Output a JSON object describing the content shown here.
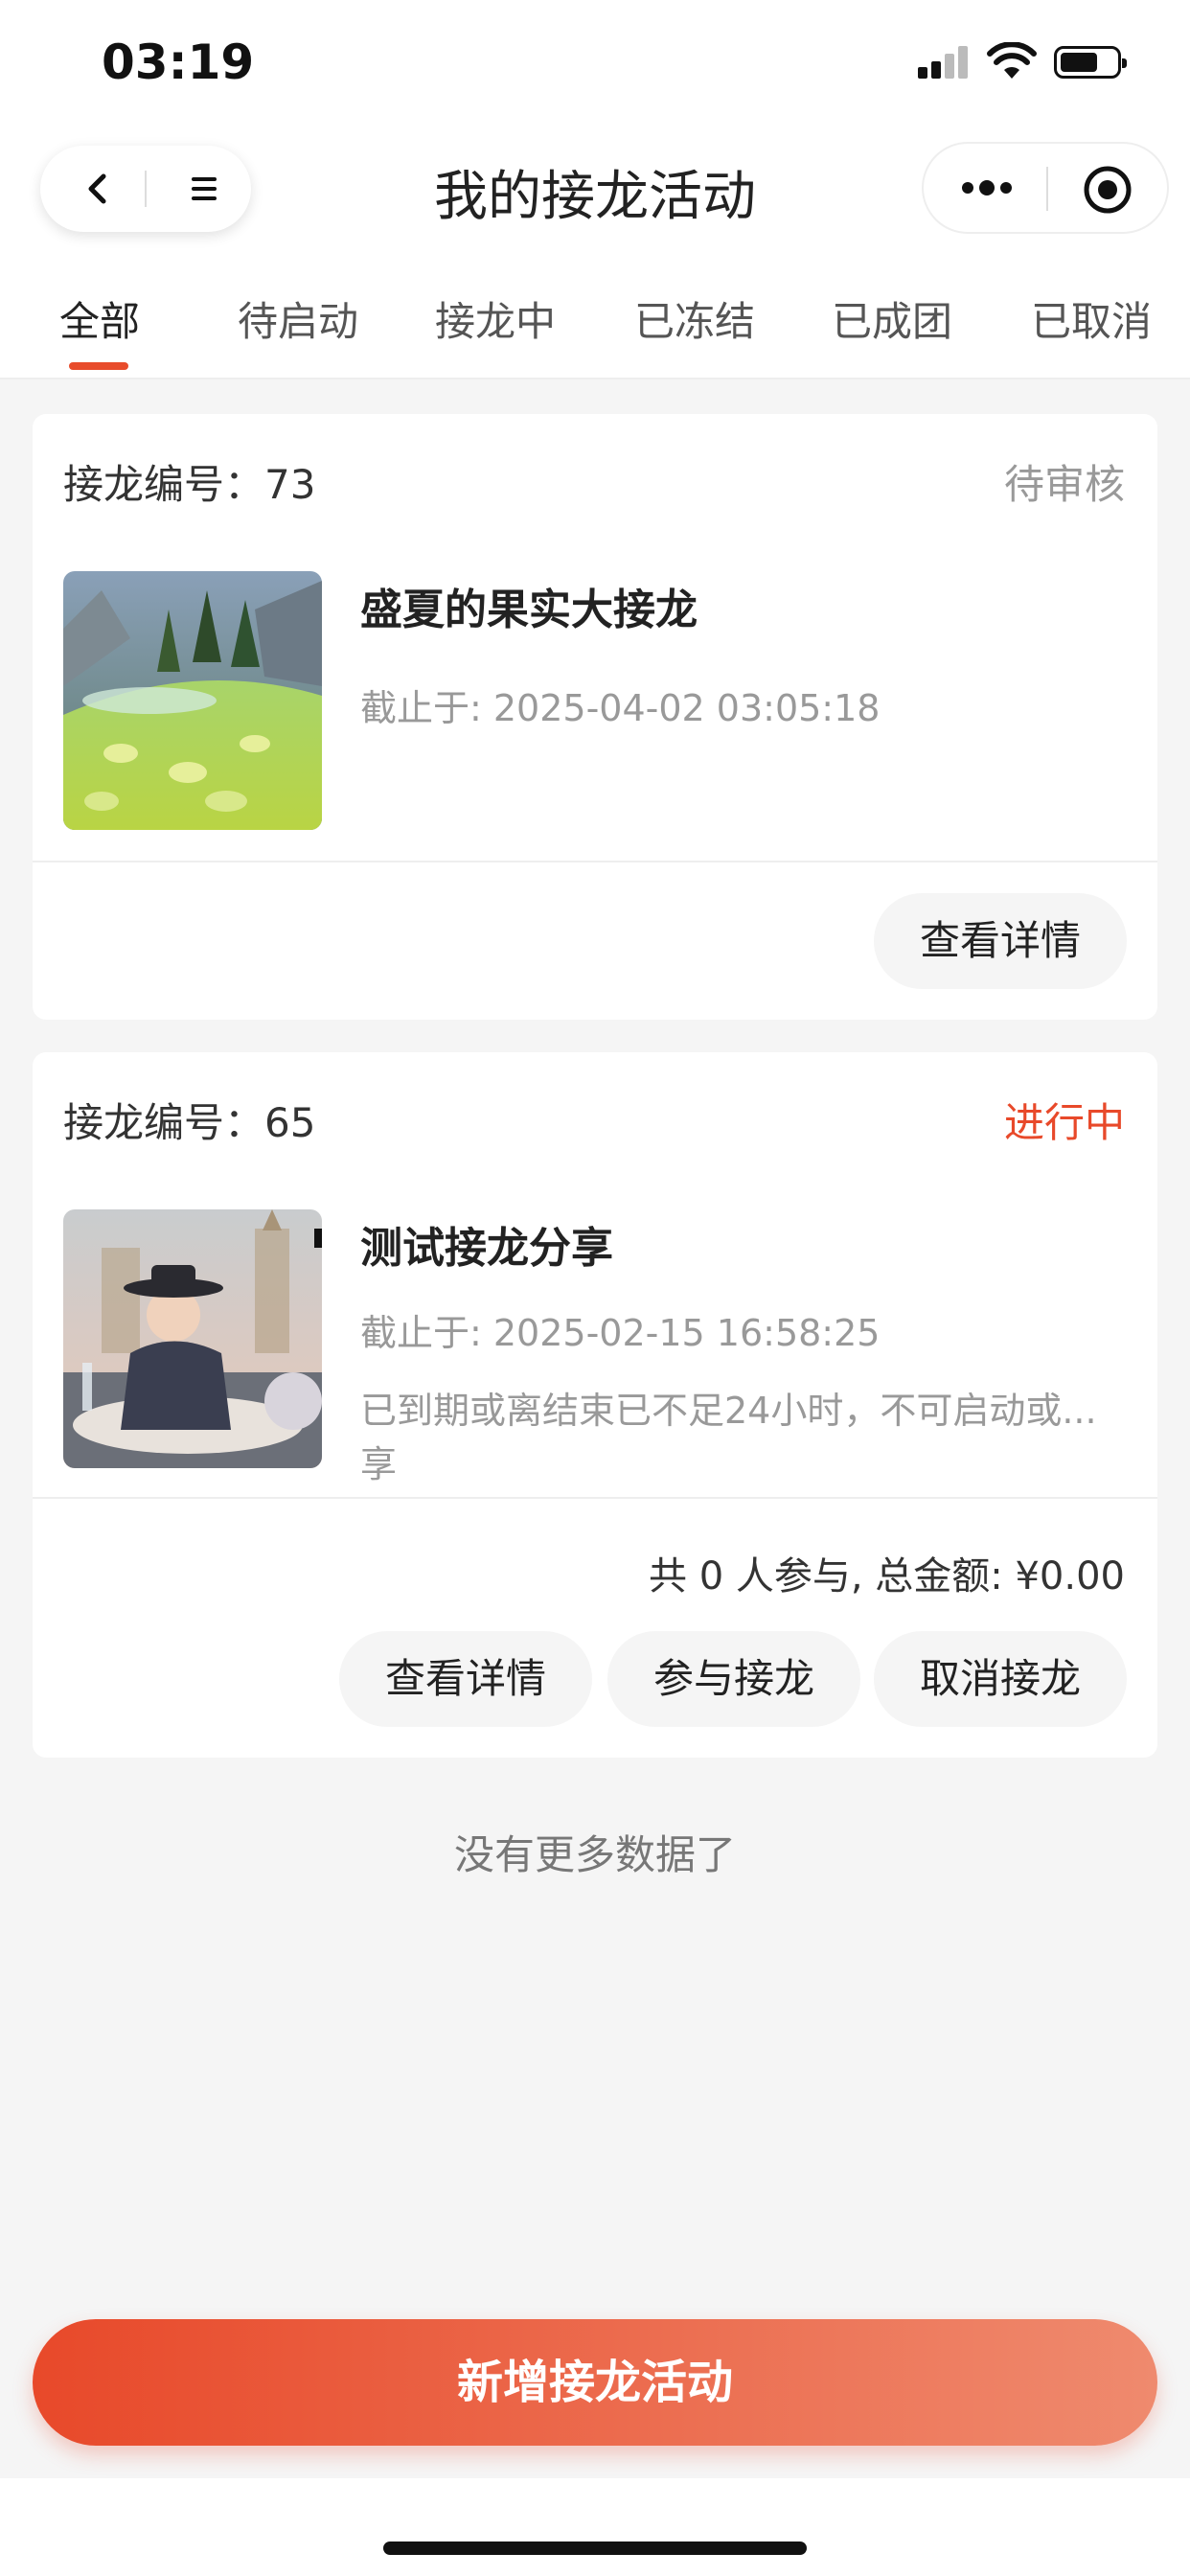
{
  "status_bar": {
    "time": "03:19"
  },
  "nav": {
    "title": "我的接龙活动"
  },
  "tabs": [
    {
      "label": "全部"
    },
    {
      "label": "待启动"
    },
    {
      "label": "接龙中"
    },
    {
      "label": "已冻结"
    },
    {
      "label": "已成团"
    },
    {
      "label": "已取消"
    }
  ],
  "cards": [
    {
      "number_label": "接龙编号：73",
      "status": "待审核",
      "title": "盛夏的果实大接龙",
      "deadline": "截止于: 2025-04-02 03:05:18",
      "buttons": [
        "查看详情"
      ]
    },
    {
      "number_label": "接龙编号：65",
      "status": "进行中",
      "title": "测试接龙分享",
      "deadline": "截止于: 2025-02-15 16:58:25",
      "note": "已到期或离结束已不足24小时，不可启动或...享",
      "summary": "共 0 人参与, 总金额: ¥0.00",
      "buttons": [
        "查看详情",
        "参与接龙",
        "取消接龙"
      ]
    }
  ],
  "footer": {
    "no_more": "没有更多数据了",
    "add_button": "新增接龙活动"
  },
  "colors": {
    "accent": "#e8492a",
    "status_pending": "#999999",
    "status_active": "#e8492a"
  }
}
